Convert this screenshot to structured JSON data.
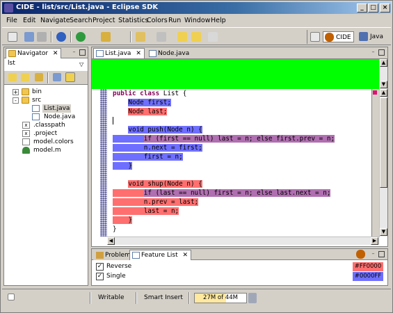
{
  "window": {
    "title": "CIDE - list/src/List.java - Eclipse SDK",
    "controls": {
      "minimize": "_",
      "maximize": "□",
      "close": "×"
    }
  },
  "menu": [
    "File",
    "Edit",
    "Navigate",
    "Search",
    "Project",
    "Statistics",
    "Colors",
    "Run",
    "Window",
    "Help"
  ],
  "toolbar": {
    "icons": [
      "new-icon",
      "save-icon",
      "print-icon",
      "debug-icon",
      "run-icon",
      "search-icon",
      "prev-edit-icon",
      "next-annotation-icon",
      "back-icon",
      "forward-icon"
    ],
    "perspectives": [
      {
        "label": "CIDE",
        "active": true
      },
      {
        "label": "Java",
        "active": false
      }
    ]
  },
  "navigator": {
    "tab_label": "Navigator",
    "project_path": "lst",
    "tree": [
      {
        "label": "bin",
        "type": "folder",
        "toggle": "+",
        "indent": 0
      },
      {
        "label": "src",
        "type": "folder",
        "toggle": "-",
        "indent": 0
      },
      {
        "label": "List.java",
        "type": "java",
        "indent": 1,
        "selected": true
      },
      {
        "label": "Node.java",
        "type": "java",
        "indent": 1
      },
      {
        "label": ".classpath",
        "type": "x",
        "indent": 0
      },
      {
        "label": ".project",
        "type": "x",
        "indent": 0
      },
      {
        "label": "model.colors",
        "type": "file",
        "indent": 0
      },
      {
        "label": "model.m",
        "type": "model",
        "indent": 0
      }
    ]
  },
  "editor": {
    "tabs": [
      {
        "label": "List.java",
        "active": true
      },
      {
        "label": "Node.java",
        "active": false
      }
    ],
    "code": [
      {
        "parts": [
          {
            "t": "public class",
            "c": "kw"
          },
          {
            "t": " List {",
            "c": ""
          }
        ]
      },
      {
        "parts": [
          {
            "t": "    ",
            "c": ""
          },
          {
            "t": "Node first;",
            "c": "hl-blue"
          }
        ]
      },
      {
        "parts": [
          {
            "t": "    ",
            "c": ""
          },
          {
            "t": "Node last;",
            "c": "hl-red"
          }
        ]
      },
      {
        "parts": [
          {
            "t": "",
            "c": ""
          }
        ],
        "caret": true
      },
      {
        "parts": [
          {
            "t": "    ",
            "c": ""
          },
          {
            "t": "void push(Node n) {",
            "c": "hl-blue"
          }
        ]
      },
      {
        "parts": [
          {
            "t": "    ",
            "c": "hl-blue"
          },
          {
            "t": "    ",
            "c": "hl-blue"
          },
          {
            "t": "if (first == null) last = n; else first.prev = n;",
            "c": "hl-purple"
          }
        ]
      },
      {
        "parts": [
          {
            "t": "        n.next = first;",
            "c": "hl-blue"
          }
        ]
      },
      {
        "parts": [
          {
            "t": "        first = n;",
            "c": "hl-blue"
          }
        ]
      },
      {
        "parts": [
          {
            "t": "    }",
            "c": "hl-blue"
          }
        ]
      },
      {
        "parts": [
          {
            "t": "",
            "c": ""
          }
        ]
      },
      {
        "parts": [
          {
            "t": "    ",
            "c": ""
          },
          {
            "t": "void shup(Node n) {",
            "c": "hl-red"
          }
        ]
      },
      {
        "parts": [
          {
            "t": "    ",
            "c": "hl-red"
          },
          {
            "t": "    ",
            "c": "hl-red"
          },
          {
            "t": "if (last == null) first = n; else last.next = n;",
            "c": "hl-purple"
          }
        ]
      },
      {
        "parts": [
          {
            "t": "        n.prev = last;",
            "c": "hl-red"
          }
        ]
      },
      {
        "parts": [
          {
            "t": "        last = n;",
            "c": "hl-red"
          }
        ]
      },
      {
        "parts": [
          {
            "t": "    }",
            "c": "hl-red"
          }
        ]
      },
      {
        "parts": [
          {
            "t": "}",
            "c": ""
          }
        ]
      }
    ]
  },
  "bottom_views": {
    "tabs": [
      {
        "label": "Problems",
        "active": false
      },
      {
        "label": "Feature List",
        "active": true
      }
    ],
    "features": [
      {
        "name": "Reverse",
        "checked": true,
        "color": "#FF0000",
        "chip_bg": "#ff6f6f"
      },
      {
        "name": "Single",
        "checked": true,
        "color": "#0000FF",
        "chip_bg": "#6f6fff"
      }
    ]
  },
  "status": {
    "writable": "Writable",
    "insert_mode": "Smart Insert",
    "heap": "27M of 44M",
    "heap_fraction": 0.61
  }
}
